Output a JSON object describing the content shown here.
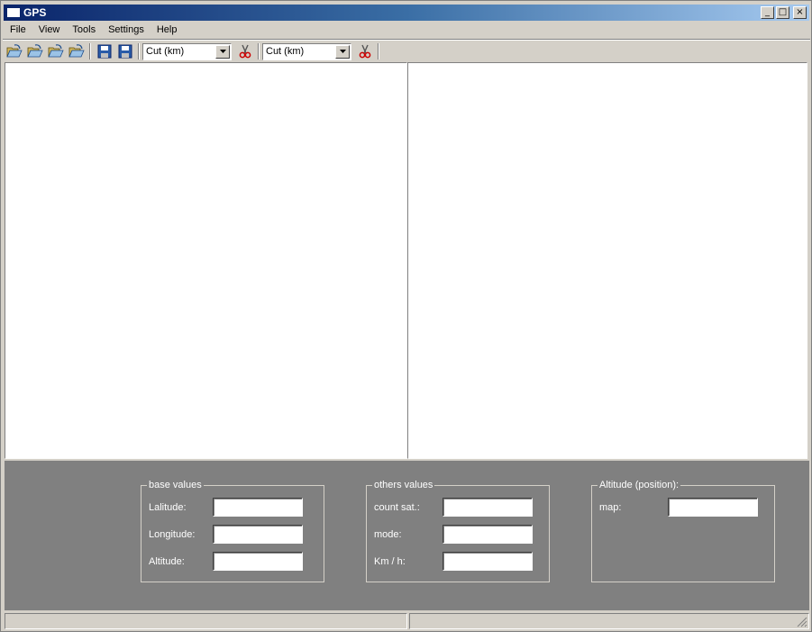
{
  "window": {
    "title": "GPS",
    "buttons": {
      "minimize": "_",
      "maximize": "□",
      "close": "×"
    }
  },
  "menu": [
    "File",
    "View",
    "Tools",
    "Settings",
    "Help"
  ],
  "toolbar": {
    "open_icons": [
      "open-icon",
      "open-icon",
      "open-icon",
      "open-icon"
    ],
    "save_icons": [
      "save-icon",
      "save-icon"
    ],
    "combo1": {
      "value": "Cut (km)"
    },
    "combo2": {
      "value": "Cut (km)"
    },
    "cut_icon": "scissors-icon"
  },
  "groups": {
    "base": {
      "title": "base values",
      "fields": [
        {
          "label": "Lalitude:",
          "value": ""
        },
        {
          "label": "Longitude:",
          "value": ""
        },
        {
          "label": "Altitude:",
          "value": ""
        }
      ]
    },
    "others": {
      "title": "others values",
      "fields": [
        {
          "label": "count sat.:",
          "value": ""
        },
        {
          "label": "mode:",
          "value": ""
        },
        {
          "label": "Km / h:",
          "value": ""
        }
      ]
    },
    "altitude": {
      "title": "Altitude (position):",
      "fields": [
        {
          "label": "map:",
          "value": ""
        }
      ]
    }
  },
  "colors": {
    "title_start": "#0a246a",
    "title_end": "#a6caf0",
    "panel": "#808080",
    "face": "#d4d0c8"
  }
}
